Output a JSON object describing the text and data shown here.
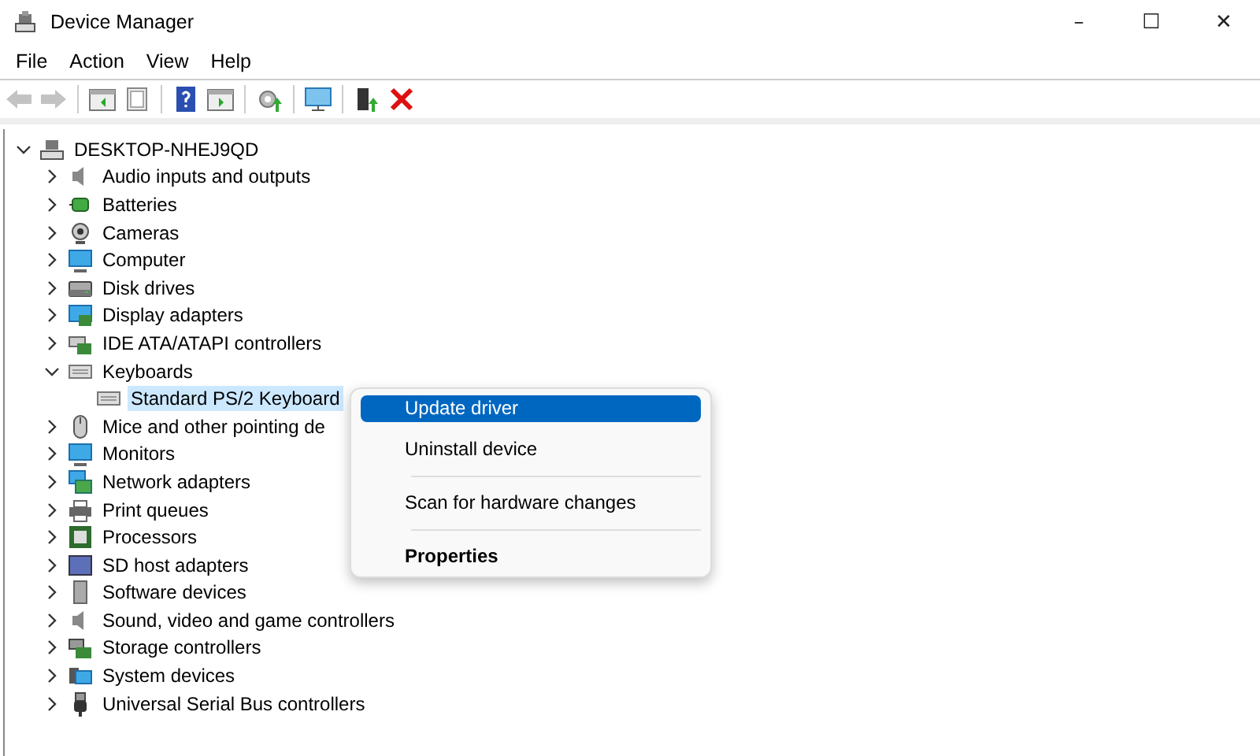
{
  "window": {
    "title": "Device Manager",
    "controls": [
      "–",
      "☐",
      "✕"
    ]
  },
  "menu_bar": [
    "File",
    "Action",
    "View",
    "Help"
  ],
  "toolbar": [
    {
      "disabled": true
    },
    {
      "disabled": true
    },
    {
      "disabled": false
    },
    {
      "disabled": false
    },
    {
      "disabled": false
    },
    {
      "disabled": false
    },
    {
      "disabled": false
    },
    {
      "disabled": false
    },
    {
      "disabled": false
    },
    {
      "disabled": false
    }
  ],
  "tree": [
    {
      "label": "DESKTOP-NHEJ9QD",
      "expanded": true,
      "selected": false,
      "children": [
        {
          "label": "Audio inputs and outputs",
          "expanded": false,
          "selected": false
        },
        {
          "label": "Batteries",
          "expanded": false,
          "selected": false
        },
        {
          "label": "Cameras",
          "expanded": false,
          "selected": false
        },
        {
          "label": "Computer",
          "expanded": false,
          "selected": false
        },
        {
          "label": "Disk drives",
          "expanded": false,
          "selected": false
        },
        {
          "label": "Display adapters",
          "expanded": false,
          "selected": false
        },
        {
          "label": "IDE ATA/ATAPI controllers",
          "expanded": false,
          "selected": false
        },
        {
          "label": "Keyboards",
          "expanded": true,
          "selected": false,
          "children": [
            {
              "label": "Standard PS/2 Keyboard",
              "selected": true
            }
          ]
        },
        {
          "label": "Mice and other pointing de",
          "expanded": false,
          "selected": false
        },
        {
          "label": "Monitors",
          "expanded": false,
          "selected": false
        },
        {
          "label": "Network adapters",
          "expanded": false,
          "selected": false
        },
        {
          "label": "Print queues",
          "expanded": false,
          "selected": false
        },
        {
          "label": "Processors",
          "expanded": false,
          "selected": false
        },
        {
          "label": "SD host adapters",
          "expanded": false,
          "selected": false
        },
        {
          "label": "Software devices",
          "expanded": false,
          "selected": false
        },
        {
          "label": "Sound, video and game controllers",
          "expanded": false,
          "selected": false
        },
        {
          "label": "Storage controllers",
          "expanded": false,
          "selected": false
        },
        {
          "label": "System devices",
          "expanded": false,
          "selected": false
        },
        {
          "label": "Universal Serial Bus controllers",
          "expanded": false,
          "selected": false
        }
      ]
    }
  ],
  "context_menu": [
    {
      "kind": "item",
      "label": "Update driver",
      "selected": true,
      "default": false
    },
    {
      "kind": "item",
      "label": "Uninstall device",
      "selected": false,
      "default": false
    },
    {
      "kind": "separator"
    },
    {
      "kind": "item",
      "label": "Scan for hardware changes",
      "selected": false,
      "default": false
    },
    {
      "kind": "separator"
    },
    {
      "kind": "item",
      "label": "Properties",
      "selected": false,
      "default": true
    }
  ]
}
